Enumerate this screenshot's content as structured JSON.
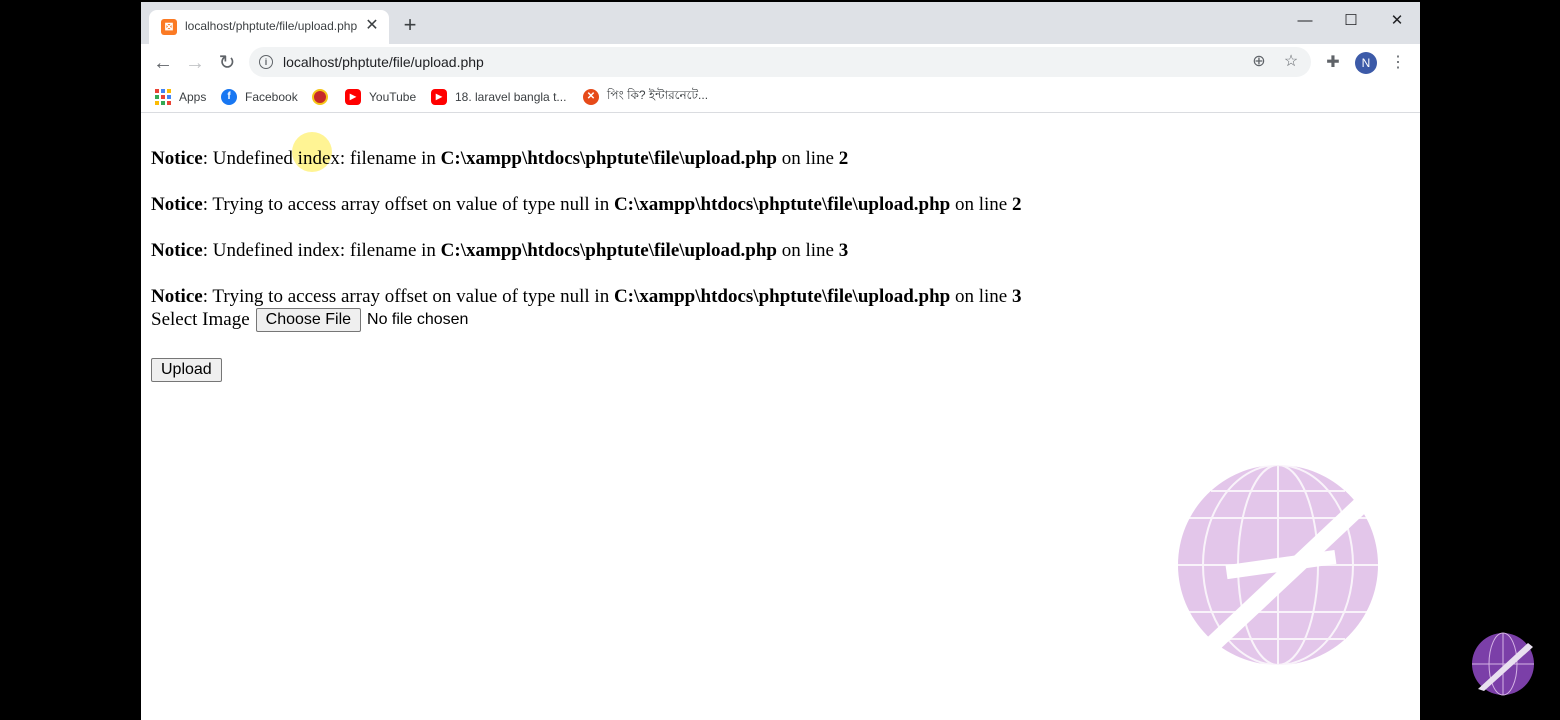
{
  "tab": {
    "title": "localhost/phptute/file/upload.php",
    "favicon": "xampp-icon"
  },
  "window_controls": {
    "minimize": "—",
    "maximize": "☐",
    "close": "✕"
  },
  "address_bar": {
    "url": "localhost/phptute/file/upload.php"
  },
  "profile": {
    "initial": "N",
    "color": "#3c5aa8"
  },
  "bookmarks": [
    {
      "label": "Apps",
      "icon": "apps-grid-icon"
    },
    {
      "label": "Facebook",
      "icon": "facebook-icon"
    },
    {
      "label": "",
      "icon": "red-circle-icon"
    },
    {
      "label": "YouTube",
      "icon": "youtube-icon"
    },
    {
      "label": "18. laravel bangla t...",
      "icon": "youtube-icon"
    },
    {
      "label": "পিং কি? ইন্টারনেটে...",
      "icon": "ping-icon"
    }
  ],
  "notices": [
    {
      "label": "Notice",
      "message": "Undefined index: filename in",
      "path": "C:\\xampp\\htdocs\\phptute\\file\\upload.php",
      "suffix": "on line",
      "line": "2"
    },
    {
      "label": "Notice",
      "message": "Trying to access array offset on value of type null in",
      "path": "C:\\xampp\\htdocs\\phptute\\file\\upload.php",
      "suffix": "on line",
      "line": "2"
    },
    {
      "label": "Notice",
      "message": "Undefined index: filename in",
      "path": "C:\\xampp\\htdocs\\phptute\\file\\upload.php",
      "suffix": "on line",
      "line": "3"
    },
    {
      "label": "Notice",
      "message": "Trying to access array offset on value of type null in",
      "path": "C:\\xampp\\htdocs\\phptute\\file\\upload.php",
      "suffix": "on line",
      "line": "3"
    }
  ],
  "form": {
    "label": "Select Image",
    "choose_button": "Choose File",
    "file_status": "No file chosen",
    "upload_button": "Upload"
  },
  "colors": {
    "background": "#000000",
    "tabstrip": "#dee1e6",
    "watermark": "#e3c6ea",
    "corner_logo": "#7b3fa8"
  }
}
